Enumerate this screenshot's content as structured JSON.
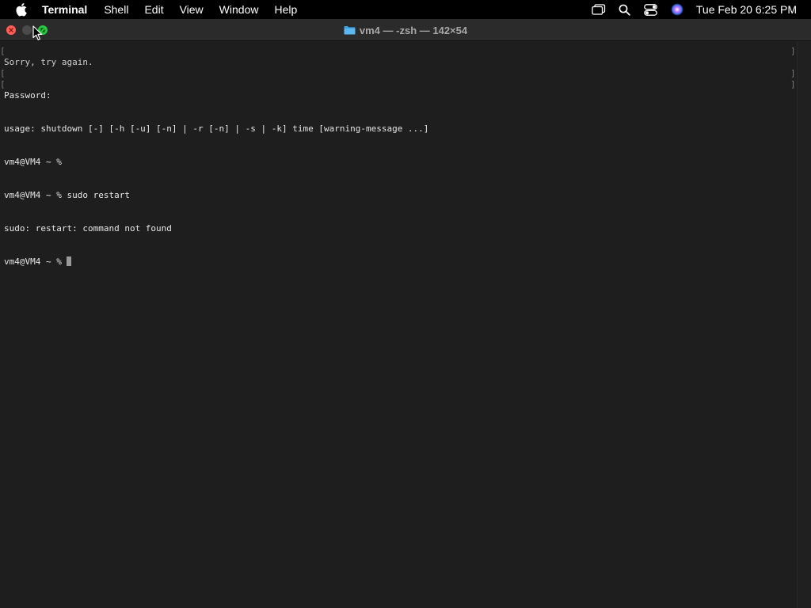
{
  "menubar": {
    "app_name": "Terminal",
    "items": [
      "Shell",
      "Edit",
      "View",
      "Window",
      "Help"
    ],
    "clock": "Tue Feb 20  6:25 PM",
    "status_icons": [
      "screen-mirroring-icon",
      "search-icon",
      "control-center-icon",
      "siri-icon"
    ]
  },
  "window": {
    "title": "vm4 — -zsh — 142×54",
    "title_icon": "folder-icon"
  },
  "terminal": {
    "lines": [
      "Sorry, try again.",
      "Password:",
      "usage: shutdown [-] [-h [-u] [-n] | -r [-n] | -s | -k] time [warning-message ...]",
      "vm4@VM4 ~ %",
      "vm4@VM4 ~ % sudo restart",
      "sudo: restart: command not found"
    ],
    "prompt": "vm4@VM4 ~ % "
  },
  "colors": {
    "background": "#1e1e1e",
    "text": "#e6e6e6",
    "close": "#ff5f57",
    "zoom": "#28c840"
  }
}
